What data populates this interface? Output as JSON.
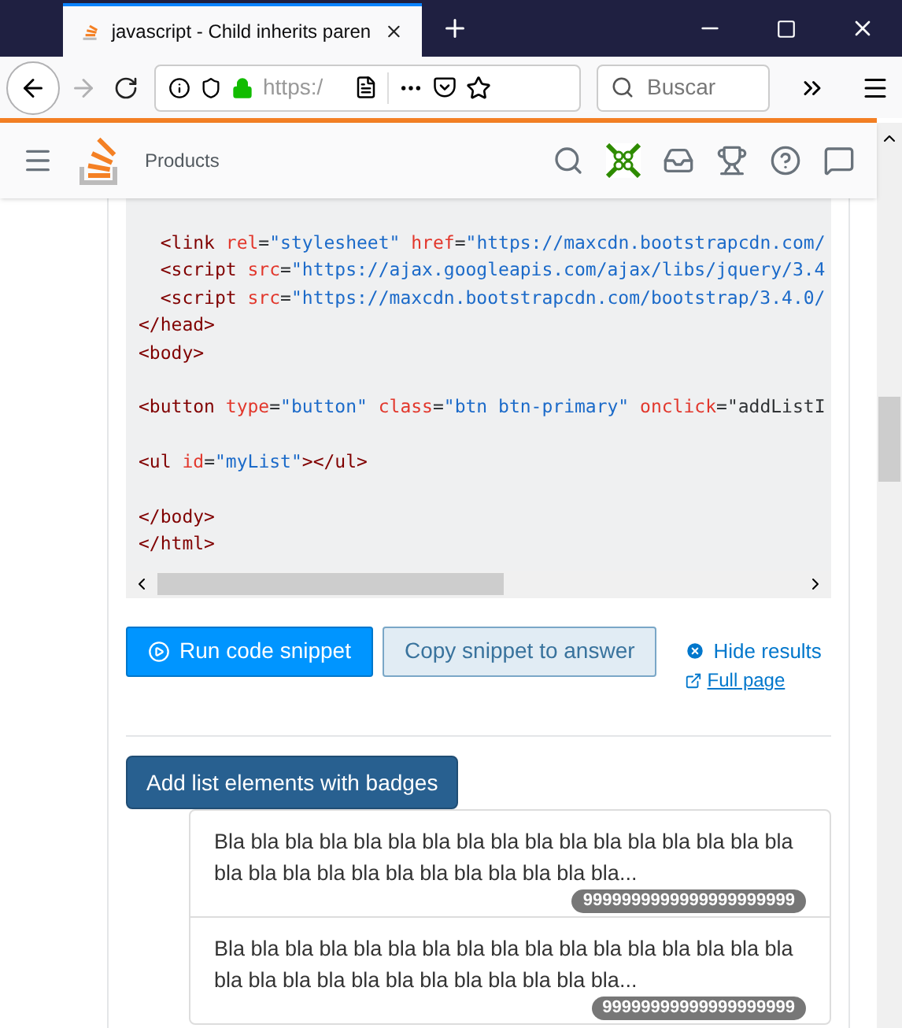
{
  "browser": {
    "tab_title": "javascript - Child inherits paren",
    "url": "https:/",
    "search_placeholder": "Buscar"
  },
  "site_header": {
    "products": "Products"
  },
  "code_lines": [
    {
      "space_before": false,
      "segments": [
        {
          "kind": "tag",
          "text": "  <link "
        },
        {
          "kind": "attr",
          "text": "rel"
        },
        {
          "kind": "punct",
          "text": "="
        },
        {
          "kind": "value",
          "text": "\"stylesheet\" "
        },
        {
          "kind": "attr",
          "text": "href"
        },
        {
          "kind": "punct",
          "text": "="
        },
        {
          "kind": "value",
          "text": "\"https://maxcdn.bootstrapcdn.com/"
        }
      ]
    },
    {
      "space_before": false,
      "segments": [
        {
          "kind": "tag",
          "text": "  <script "
        },
        {
          "kind": "attr",
          "text": "src"
        },
        {
          "kind": "punct",
          "text": "="
        },
        {
          "kind": "value",
          "text": "\"https://ajax.googleapis.com/ajax/libs/jquery/3.4"
        }
      ]
    },
    {
      "space_before": false,
      "segments": [
        {
          "kind": "tag",
          "text": "  <script "
        },
        {
          "kind": "attr",
          "text": "src"
        },
        {
          "kind": "punct",
          "text": "="
        },
        {
          "kind": "value",
          "text": "\"https://maxcdn.bootstrapcdn.com/bootstrap/3.4.0/"
        }
      ]
    },
    {
      "space_before": false,
      "segments": [
        {
          "kind": "tag",
          "text": "</head>"
        }
      ]
    },
    {
      "space_before": false,
      "segments": [
        {
          "kind": "tag",
          "text": "<body>"
        }
      ]
    },
    {
      "space_before": true,
      "segments": [
        {
          "kind": "tag",
          "text": "<button "
        },
        {
          "kind": "attr",
          "text": "type"
        },
        {
          "kind": "punct",
          "text": "="
        },
        {
          "kind": "value",
          "text": "\"button\" "
        },
        {
          "kind": "attr",
          "text": "class"
        },
        {
          "kind": "punct",
          "text": "="
        },
        {
          "kind": "value",
          "text": "\"btn btn-primary\" "
        },
        {
          "kind": "attr",
          "text": "onclick"
        },
        {
          "kind": "punct",
          "text": "="
        },
        {
          "kind": "plain",
          "text": "\"addListI"
        }
      ]
    },
    {
      "space_before": true,
      "segments": [
        {
          "kind": "tag",
          "text": "<ul "
        },
        {
          "kind": "attr",
          "text": "id"
        },
        {
          "kind": "punct",
          "text": "="
        },
        {
          "kind": "value",
          "text": "\"myList\""
        },
        {
          "kind": "tag",
          "text": "></ul>"
        }
      ]
    },
    {
      "space_before": true,
      "segments": [
        {
          "kind": "tag",
          "text": "</body>"
        }
      ]
    },
    {
      "space_before": false,
      "segments": [
        {
          "kind": "tag",
          "text": "</html>"
        }
      ]
    }
  ],
  "snippet_actions": {
    "run": "Run code snippet",
    "copy": "Copy snippet to answer",
    "hide": "Hide results",
    "full": "Full page"
  },
  "result": {
    "button": "Add list elements with badges",
    "items": [
      {
        "text": "Bla bla bla bla bla bla bla bla bla bla bla bla bla bla bla bla bla bla bla bla bla bla bla bla bla bla bla bla bla...",
        "badge": "9999999999999999999999"
      },
      {
        "text": "Bla bla bla bla bla bla bla bla bla bla bla bla bla bla bla bla bla bla bla bla bla bla bla bla bla bla bla bla bla...",
        "badge": "99999999999999999999"
      }
    ]
  }
}
